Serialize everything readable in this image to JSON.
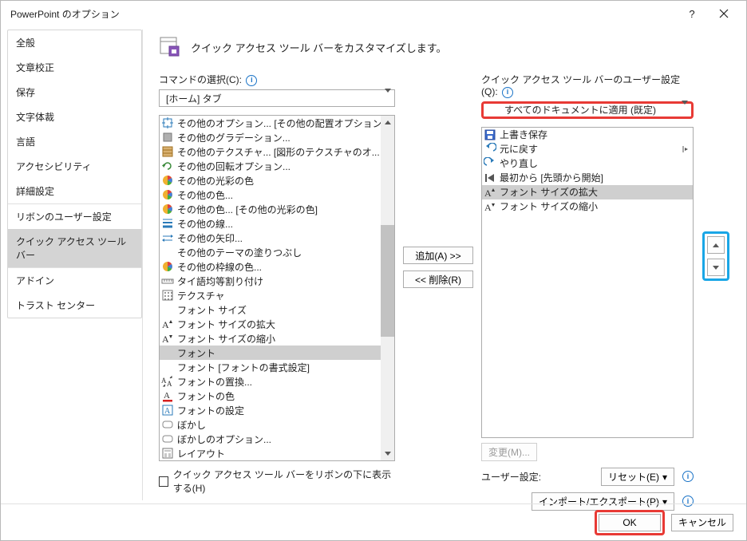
{
  "window": {
    "title": "PowerPoint のオプション"
  },
  "sidebar": {
    "items": [
      {
        "label": "全般"
      },
      {
        "label": "文章校正"
      },
      {
        "label": "保存"
      },
      {
        "label": "文字体裁"
      },
      {
        "label": "言語"
      },
      {
        "label": "アクセシビリティ"
      },
      {
        "label": "詳細設定"
      },
      {
        "label": "リボンのユーザー設定"
      },
      {
        "label": "クイック アクセス ツール バー",
        "selected": true
      },
      {
        "label": "アドイン"
      },
      {
        "label": "トラスト センター"
      }
    ],
    "separators_after": [
      6,
      8
    ]
  },
  "header": {
    "subtitle": "クイック アクセス ツール バーをカスタマイズします。"
  },
  "left": {
    "label": "コマンドの選択(C):",
    "combo_value": "[ホーム] タブ",
    "items": [
      {
        "icon": "arrows-out",
        "label": "その他のオプション... [その他の配置オプション]"
      },
      {
        "icon": "gray-square",
        "label": "その他のグラデーション..."
      },
      {
        "icon": "texture",
        "label": "その他のテクスチャ... [図形のテクスチャのオ..."
      },
      {
        "icon": "rotate",
        "label": "その他の回転オプション..."
      },
      {
        "icon": "pie-multi",
        "label": "その他の光彩の色",
        "indicator": "menu"
      },
      {
        "icon": "pie-multi",
        "label": "その他の色..."
      },
      {
        "icon": "pie-multi",
        "label": "その他の色... [その他の光彩の色]"
      },
      {
        "icon": "lines",
        "label": "その他の線..."
      },
      {
        "icon": "arrows-lr",
        "label": "その他の矢印..."
      },
      {
        "icon": "blank",
        "label": "その他のテーマの塗りつぶし",
        "indicator": "menu"
      },
      {
        "icon": "pie-multi",
        "label": "その他の枠線の色..."
      },
      {
        "icon": "ruler",
        "label": "タイ語均等割り付け"
      },
      {
        "icon": "pattern",
        "label": "テクスチャ",
        "indicator": "menu"
      },
      {
        "icon": "blank",
        "label": "フォント サイズ",
        "indicator": "edit"
      },
      {
        "icon": "font-grow",
        "label": "フォント サイズの拡大"
      },
      {
        "icon": "font-shrink",
        "label": "フォント サイズの縮小"
      },
      {
        "icon": "blank",
        "label": "フォント",
        "selected": true,
        "indicator": "edit"
      },
      {
        "icon": "blank",
        "label": "フォント [フォントの書式設定]"
      },
      {
        "icon": "font-replace",
        "label": "フォントの置換..."
      },
      {
        "icon": "a-red-underline",
        "label": "フォントの色",
        "indicator": "split"
      },
      {
        "icon": "a-blue-box",
        "label": "フォントの設定"
      },
      {
        "icon": "rounded",
        "label": "ぼかし",
        "indicator": "menu"
      },
      {
        "icon": "rounded",
        "label": "ぼかしのオプション..."
      },
      {
        "icon": "layout",
        "label": "レイアウト",
        "indicator": "menu"
      }
    ],
    "show_below_ribbon_label": "クイック アクセス ツール バーをリボンの下に表示する(H)"
  },
  "middle": {
    "add_label": "追加(A) >>",
    "remove_label": "<< 削除(R)"
  },
  "right": {
    "label": "クイック アクセス ツール バーのユーザー設定(Q):",
    "combo_value": "すべてのドキュメントに適用 (既定)",
    "items": [
      {
        "icon": "save",
        "label": "上書き保存"
      },
      {
        "icon": "undo",
        "label": "元に戻す",
        "indicator": "split"
      },
      {
        "icon": "redo",
        "label": "やり直し"
      },
      {
        "icon": "from-beginning",
        "label": "最初から [先頭から開始]"
      },
      {
        "icon": "font-grow",
        "label": "フォント サイズの拡大",
        "selected": true
      },
      {
        "icon": "font-shrink",
        "label": "フォント サイズの縮小"
      }
    ],
    "modify_label": "変更(M)...",
    "user_setting_label": "ユーザー設定:",
    "reset_label": "リセット(E)",
    "import_export_label": "インポート/エクスポート(P)"
  },
  "footer": {
    "ok": "OK",
    "cancel": "キャンセル"
  }
}
